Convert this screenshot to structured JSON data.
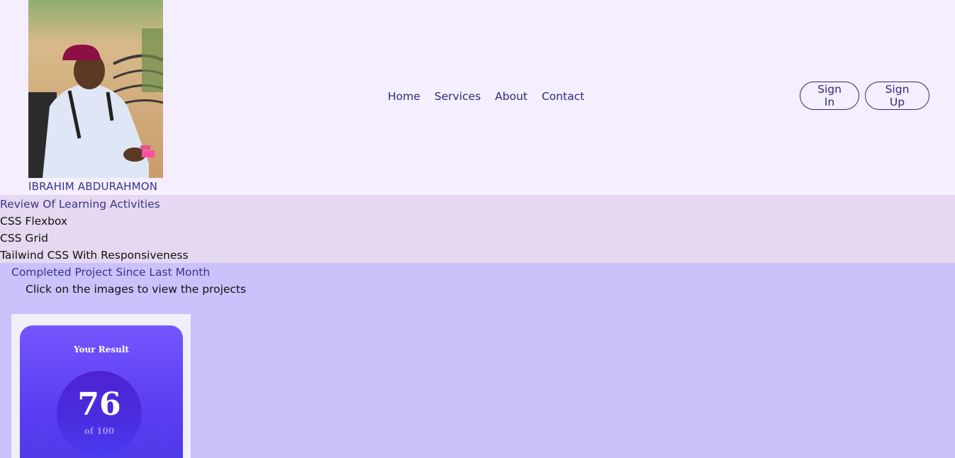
{
  "header": {
    "profile_name": "IBRAHIM ABDURAHMON",
    "nav": [
      "Home",
      "Services",
      "About",
      "Contact"
    ],
    "sign_in": "Sign In",
    "sign_up": "Sign Up"
  },
  "review": {
    "title": "Review Of Learning Activities",
    "items": [
      "CSS Flexbox",
      "CSS Grid",
      "Tailwind CSS With Responsiveness"
    ]
  },
  "completed": {
    "title": "Completed Project Since Last Month",
    "hint": "Click on the images to view the projects",
    "project": {
      "card_title": "Your Result",
      "score": "76",
      "score_of": "of 100"
    }
  },
  "colors": {
    "header_bg": "#f4eefe",
    "review_bg": "#e5d8f0",
    "page_bg": "#cbc1fb",
    "accent_text": "#2e2b78"
  }
}
